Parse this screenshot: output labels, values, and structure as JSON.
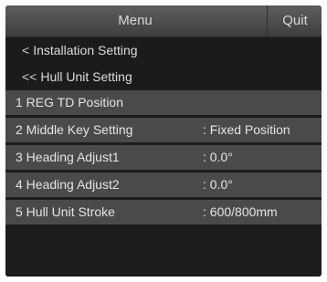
{
  "header": {
    "title": "Menu",
    "quit_label": "Quit"
  },
  "breadcrumb": [
    {
      "chevron": "<",
      "label": "Installation Setting"
    },
    {
      "chevron": "<<",
      "label": "Hull Unit Setting"
    }
  ],
  "menu_items": [
    {
      "label": "1 REG TD Position",
      "value": ""
    },
    {
      "label": "2 Middle Key Setting",
      "value": ": Fixed Position"
    },
    {
      "label": "3 Heading Adjust1",
      "value": ": 0.0°"
    },
    {
      "label": "4 Heading Adjust2",
      "value": ": 0.0°"
    },
    {
      "label": "5 Hull Unit Stroke",
      "value": ": 600/800mm"
    }
  ]
}
